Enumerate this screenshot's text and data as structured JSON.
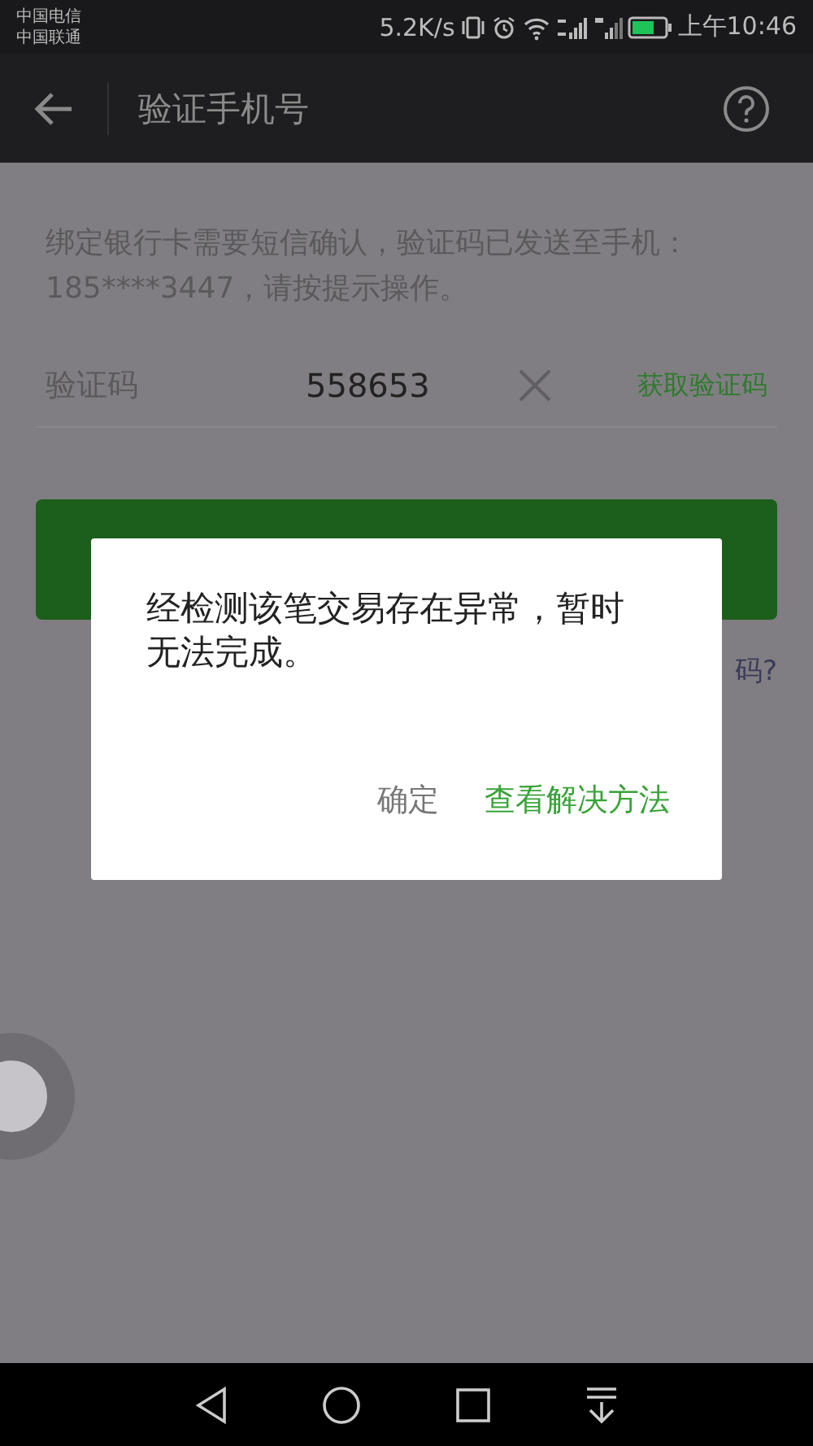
{
  "status_bar": {
    "carriers": [
      "中国电信",
      "中国联通"
    ],
    "speed": "5.2K/s",
    "time": "上午10:46"
  },
  "header": {
    "title": "验证手机号"
  },
  "notice": "绑定银行卡需要短信确认，验证码已发送至手机：185****3447，请按提示操作。",
  "code_field": {
    "label": "验证码",
    "value": "558653",
    "action": "获取验证码"
  },
  "help_link": "码?",
  "dialog": {
    "message": "经检测该笔交易存在异常，暂时无法完成。",
    "buttons": [
      {
        "label": "确定",
        "kind": "plain"
      },
      {
        "label": "查看解决方法",
        "kind": "primary"
      }
    ]
  }
}
